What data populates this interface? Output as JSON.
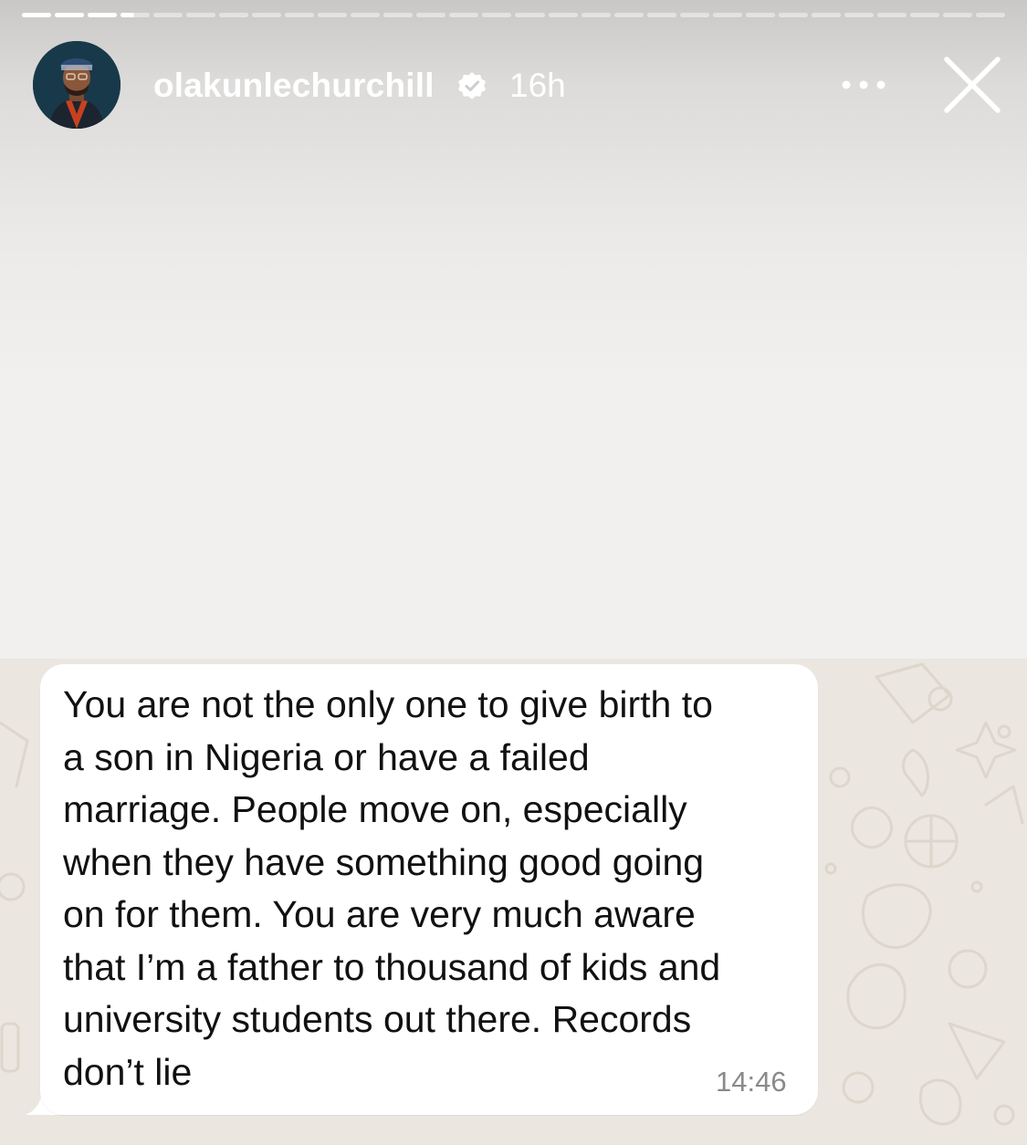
{
  "story": {
    "progress": {
      "total_segments": 30,
      "completed_segments": 3,
      "current_segment_progress": 0.45
    },
    "username": "olakunlechurchill",
    "verified": true,
    "time_ago": "16h",
    "icons": {
      "verified": "verified-badge-icon",
      "more": "more-options-icon",
      "close": "close-icon"
    }
  },
  "chat": {
    "message": {
      "lines": [
        "You are not the only one to give birth to",
        "a son in Nigeria or have a failed",
        "marriage. People move on, especially",
        "when they have something good going",
        "on for them. You are very much aware",
        "that I’m a father to thousand of kids and",
        "university students out there. Records",
        "don’t lie"
      ],
      "time": "14:46"
    }
  },
  "colors": {
    "chat_background": "#ebe6df",
    "bubble": "#ffffff",
    "text": "#111111",
    "timestamp": "#8a8a8a"
  }
}
